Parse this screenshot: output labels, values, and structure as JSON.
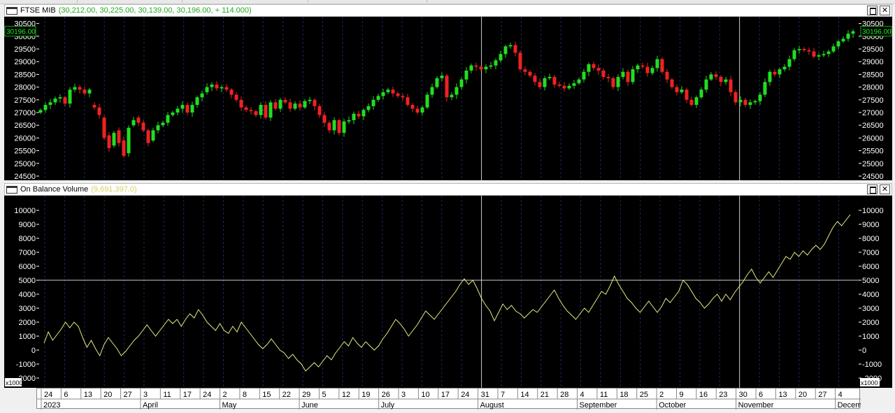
{
  "price_pane": {
    "title": "FTSE MIB",
    "values": "(30,212.00, 30,225.00, 30,139.00, 30,196.00, + 114.000)",
    "last_label": "30196.00"
  },
  "obv_pane": {
    "title": "On Balance Volume",
    "values": "(9,691,397.0)",
    "multiplier": "x1000"
  },
  "colors": {
    "up": "#22dd22",
    "down": "#ee2222",
    "obv_line": "#e8e880",
    "grid": "#1c2a5c",
    "bg": "#000000"
  },
  "icons": [
    "window-icon",
    "maximize-icon",
    "close-icon"
  ],
  "chart_data": [
    {
      "type": "candlestick",
      "title": "FTSE MIB",
      "ylim": [
        24500,
        30600
      ],
      "yticks": [
        24500,
        25000,
        25500,
        26000,
        26500,
        27000,
        27500,
        28000,
        28500,
        29000,
        29500,
        30000,
        30500
      ],
      "x_ticks": [
        "24",
        "6",
        "13",
        "20",
        "27",
        "3",
        "11",
        "17",
        "24",
        "2",
        "8",
        "15",
        "22",
        "29",
        "5",
        "12",
        "19",
        "26",
        "3",
        "10",
        "17",
        "24",
        "31",
        "7",
        "14",
        "21",
        "28",
        "4",
        "11",
        "18",
        "25",
        "2",
        "9",
        "16",
        "23",
        "30",
        "6",
        "13",
        "20",
        "27",
        "4"
      ],
      "months": [
        "2023",
        "April",
        "May",
        "June",
        "July",
        "August",
        "September",
        "October",
        "November",
        "Decem"
      ],
      "closes": [
        27100,
        27300,
        27400,
        27550,
        27600,
        27350,
        27900,
        28000,
        27900,
        27750,
        27900,
        27200,
        26900,
        26000,
        25600,
        26200,
        25800,
        25300,
        26400,
        26700,
        26600,
        26300,
        25800,
        26300,
        26500,
        26600,
        26900,
        27000,
        27150,
        27300,
        27000,
        27300,
        27600,
        27750,
        28000,
        28100,
        27950,
        28000,
        27900,
        27700,
        27500,
        27200,
        27100,
        27050,
        26900,
        27300,
        26800,
        27400,
        27150,
        27500,
        27400,
        27150,
        27350,
        27200,
        27450,
        27500,
        27250,
        26900,
        26600,
        26300,
        26700,
        26200,
        26650,
        26700,
        26950,
        26850,
        27100,
        27250,
        27500,
        27650,
        27800,
        27900,
        27750,
        27650,
        27600,
        27300,
        27150,
        27000,
        27200,
        27700,
        28000,
        28350,
        28450,
        27600,
        27700,
        28000,
        28300,
        28650,
        28850,
        28800,
        28700,
        28800,
        28850,
        29050,
        29300,
        29600,
        29650,
        29350,
        28700,
        28600,
        28450,
        28200,
        28000,
        28350,
        28400,
        28100,
        28050,
        27950,
        28050,
        28150,
        28300,
        28600,
        28900,
        28750,
        28650,
        28400,
        28350,
        28000,
        28400,
        28600,
        28200,
        28700,
        28850,
        28800,
        28550,
        28750,
        29100,
        28600,
        28300,
        28000,
        27800,
        27900,
        27500,
        27300,
        27600,
        27900,
        28300,
        28500,
        28400,
        28200,
        28300,
        27800,
        27400,
        27500,
        27300,
        27400,
        27450,
        27700,
        28200,
        28600,
        28500,
        28700,
        28800,
        29100,
        29450,
        29500,
        29450,
        29400,
        29200,
        29250,
        29300,
        29400,
        29600,
        29800,
        29900,
        30100,
        30196
      ],
      "opens": [
        27000,
        27100,
        27300,
        27400,
        27550,
        27600,
        27350,
        27900,
        28000,
        27900,
        27750,
        27300,
        27200,
        26800,
        26100,
        25700,
        26300,
        25900,
        25400,
        26500,
        26800,
        26600,
        26300,
        25900,
        26300,
        26500,
        26600,
        26900,
        27000,
        27150,
        27300,
        27000,
        27300,
        27600,
        27800,
        28000,
        28100,
        27950,
        28000,
        27900,
        27700,
        27500,
        27200,
        27100,
        27050,
        26900,
        27300,
        26800,
        27400,
        27150,
        27500,
        27400,
        27150,
        27350,
        27200,
        27450,
        27500,
        27250,
        26900,
        26600,
        26300,
        26700,
        26200,
        26650,
        26700,
        26950,
        26850,
        27100,
        27250,
        27500,
        27650,
        27800,
        27900,
        27750,
        27650,
        27600,
        27300,
        27150,
        27000,
        27200,
        27700,
        28000,
        28350,
        28450,
        27600,
        27700,
        28000,
        28300,
        28650,
        28850,
        28800,
        28700,
        28800,
        28850,
        29050,
        29300,
        29600,
        29650,
        29350,
        28700,
        28600,
        28450,
        28200,
        28000,
        28350,
        28400,
        28100,
        28050,
        27950,
        28050,
        28150,
        28300,
        28600,
        28900,
        28750,
        28650,
        28400,
        28350,
        28000,
        28400,
        28600,
        28200,
        28700,
        28850,
        28800,
        28550,
        28750,
        29100,
        28600,
        28300,
        28000,
        27800,
        27900,
        27500,
        27300,
        27600,
        27900,
        28300,
        28500,
        28400,
        28200,
        28300,
        27800,
        27400,
        27500,
        27300,
        27400,
        27450,
        27700,
        28200,
        28600,
        28500,
        28700,
        28800,
        29100,
        29450,
        29500,
        29450,
        29400,
        29200,
        29250,
        29300,
        29400,
        29600,
        29800,
        29900,
        30100
      ]
    },
    {
      "type": "line",
      "title": "On Balance Volume",
      "ylim": [
        -2000,
        10500
      ],
      "yticks": [
        -2000,
        -1000,
        0,
        1000,
        2000,
        3000,
        4000,
        5000,
        6000,
        7000,
        8000,
        9000,
        10000
      ],
      "reference_line": 5000,
      "values": [
        500,
        1300,
        700,
        1100,
        1500,
        2000,
        1600,
        2000,
        1700,
        900,
        200,
        700,
        100,
        -400,
        400,
        900,
        500,
        100,
        -400,
        -100,
        300,
        700,
        1000,
        1400,
        1800,
        1400,
        1000,
        1400,
        1800,
        2200,
        1900,
        2200,
        1700,
        2200,
        2600,
        2300,
        2900,
        2500,
        2000,
        1700,
        1400,
        1900,
        1400,
        1200,
        1700,
        1300,
        2000,
        1600,
        1200,
        800,
        400,
        100,
        400,
        800,
        400,
        0,
        -200,
        -600,
        -300,
        -700,
        -1000,
        -1500,
        -1200,
        -900,
        -1200,
        -800,
        -400,
        -700,
        -200,
        200,
        600,
        300,
        900,
        500,
        200,
        600,
        300,
        0,
        300,
        800,
        1200,
        1700,
        2200,
        1900,
        1500,
        1000,
        1400,
        1800,
        2300,
        2800,
        2500,
        2200,
        2600,
        3000,
        3400,
        3800,
        4200,
        4700,
        5100,
        4700,
        5000,
        4400,
        3700,
        3200,
        2800,
        2100,
        2700,
        3300,
        2900,
        3200,
        2800,
        2600,
        2300,
        2600,
        2900,
        2700,
        3100,
        3500,
        3900,
        4300,
        3700,
        3200,
        2800,
        2500,
        2200,
        2600,
        3000,
        2700,
        3200,
        3700,
        4200,
        4000,
        4600,
        5300,
        4700,
        4200,
        3700,
        3400,
        3000,
        2700,
        3100,
        3500,
        3100,
        2700,
        3100,
        3700,
        3400,
        3800,
        4200,
        5000,
        4700,
        4200,
        3700,
        3400,
        3000,
        3300,
        3700,
        4000,
        3500,
        4000,
        3600,
        4100,
        4500,
        4900,
        5400,
        5800,
        5200,
        4800,
        5200,
        5600,
        5200,
        5700,
        6200,
        6700,
        6500,
        7000,
        6700,
        7100,
        6800,
        7200,
        7500,
        7200,
        7600,
        8200,
        8800,
        9200,
        8900,
        9300,
        9691
      ]
    }
  ]
}
